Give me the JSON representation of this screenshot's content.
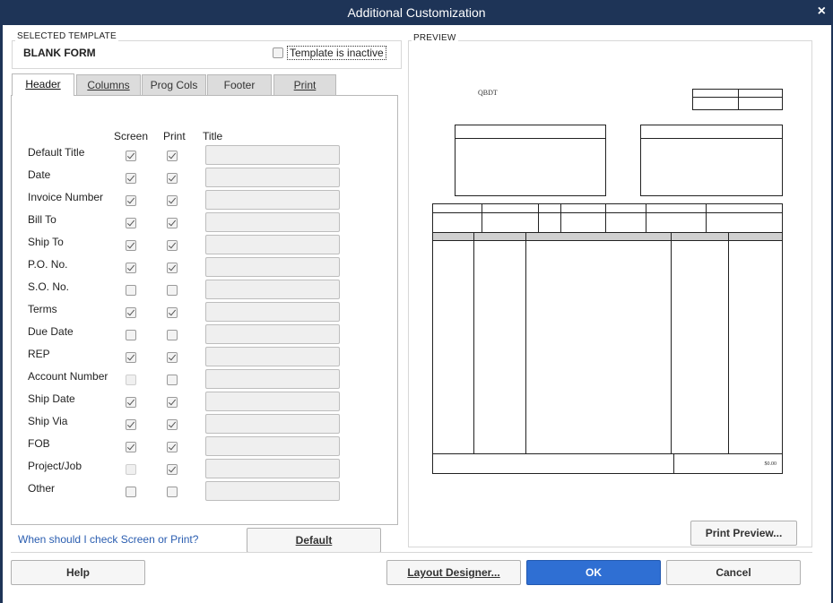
{
  "window": {
    "title": "Additional Customization",
    "close_glyph": "×"
  },
  "selected_template": {
    "group_label": "SELECTED TEMPLATE",
    "name": "BLANK FORM",
    "inactive_label": "Template is inactive",
    "inactive_checked": false
  },
  "tabs": [
    {
      "label": "Header",
      "active": true
    },
    {
      "label": "Columns",
      "active": false
    },
    {
      "label": "Prog Cols",
      "active": false
    },
    {
      "label": "Footer",
      "active": false
    },
    {
      "label": "Print",
      "active": false
    }
  ],
  "header_table": {
    "col_screen": "Screen",
    "col_print": "Print",
    "col_title": "Title",
    "rows": [
      {
        "label": "Default Title",
        "screen": "checked",
        "print": "checked",
        "title": ""
      },
      {
        "label": "Date",
        "screen": "checked",
        "print": "checked",
        "title": ""
      },
      {
        "label": "Invoice Number",
        "screen": "checked",
        "print": "checked",
        "title": ""
      },
      {
        "label": "Bill To",
        "screen": "checked",
        "print": "checked",
        "title": ""
      },
      {
        "label": "Ship To",
        "screen": "checked",
        "print": "checked",
        "title": ""
      },
      {
        "label": "P.O. No.",
        "screen": "checked",
        "print": "checked",
        "title": ""
      },
      {
        "label": "S.O. No.",
        "screen": "unchecked",
        "print": "unchecked",
        "title": ""
      },
      {
        "label": "Terms",
        "screen": "checked",
        "print": "checked",
        "title": ""
      },
      {
        "label": "Due Date",
        "screen": "unchecked",
        "print": "unchecked",
        "title": ""
      },
      {
        "label": "REP",
        "screen": "checked",
        "print": "checked",
        "title": ""
      },
      {
        "label": "Account Number",
        "screen": "disabled",
        "print": "unchecked",
        "title": ""
      },
      {
        "label": "Ship Date",
        "screen": "checked",
        "print": "checked",
        "title": ""
      },
      {
        "label": "Ship Via",
        "screen": "checked",
        "print": "checked",
        "title": ""
      },
      {
        "label": "FOB",
        "screen": "checked",
        "print": "checked",
        "title": ""
      },
      {
        "label": "Project/Job",
        "screen": "disabled",
        "print": "checked",
        "title": ""
      },
      {
        "label": "Other",
        "screen": "unchecked",
        "print": "unchecked",
        "title": ""
      }
    ]
  },
  "help_link": "When should I check Screen or Print?",
  "buttons": {
    "default": "Default",
    "help": "Help",
    "layout_designer": "Layout Designer...",
    "ok": "OK",
    "cancel": "Cancel",
    "print_preview": "Print Preview..."
  },
  "preview": {
    "group_label": "PREVIEW",
    "company": "QBDT",
    "total_value": "$0.00"
  },
  "colors": {
    "titlebar": "#1e3457",
    "primary_button": "#2f6fd3",
    "link": "#2a5db0"
  }
}
